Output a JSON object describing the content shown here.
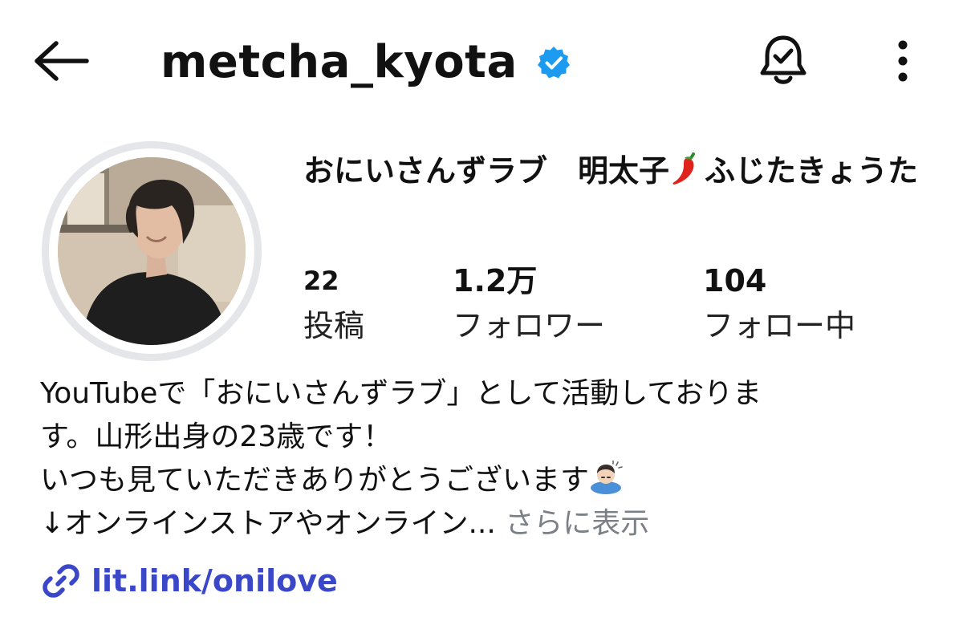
{
  "header": {
    "back_icon": "arrow-left-icon",
    "username": "metcha_kyota",
    "verified_icon": "verified-badge-icon",
    "verified_color": "#1d9bf0",
    "bell_icon": "bell-check-icon",
    "more_icon": "more-vertical-icon"
  },
  "profile": {
    "avatar_icon": "profile-photo",
    "display_name_part1": "おにいさんずラブ　明太子",
    "display_name_emoji": "chili-pepper-emoji",
    "display_name_part2": "ふじたきょうた",
    "stats": [
      {
        "value": "22",
        "label": "投稿"
      },
      {
        "value": "1.2万",
        "label": "フォロワー"
      },
      {
        "value": "104",
        "label": "フォロー中"
      }
    ]
  },
  "bio": {
    "line1": "YouTubeで「おにいさんずラブ」として活動しておりま",
    "line2": "す。山形出身の23歳です！",
    "line3": "いつも見ていただきありがとうございます",
    "line3_emoji": "bowing-person-emoji",
    "line4": "↓オンラインストアやオンライン...",
    "more_label": "さらに表示",
    "more_color": "#7b7f86"
  },
  "link": {
    "icon": "link-icon",
    "text": "lit.link/onilove",
    "color": "#3b47c9"
  }
}
